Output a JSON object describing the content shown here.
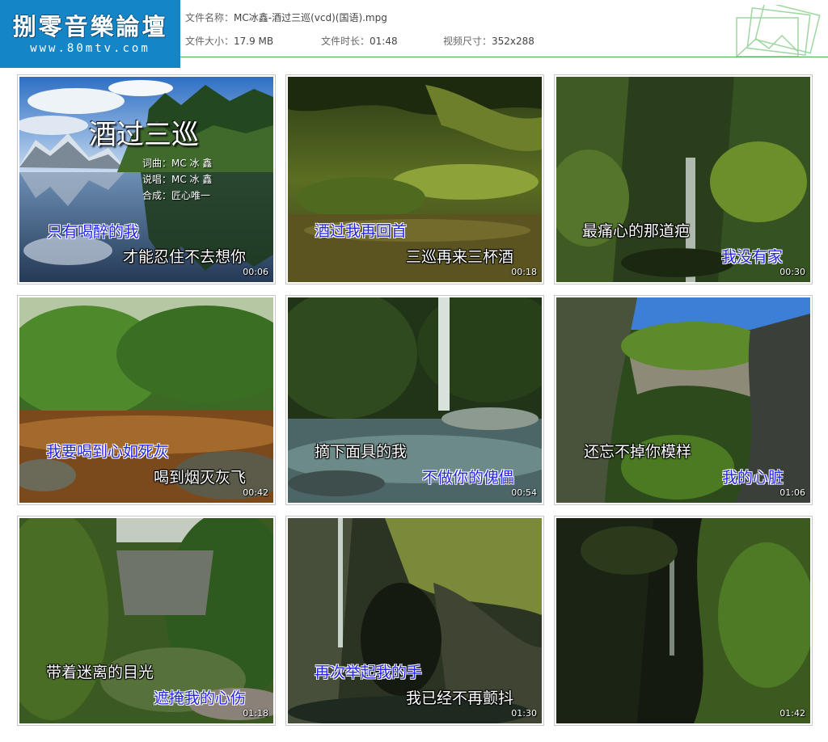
{
  "logo": {
    "title": "捌零音樂論壇",
    "url": "www.80mtv.com"
  },
  "file_info": {
    "name_label": "文件名称：",
    "name_value": "MC冰鑫-酒过三巡(vcd)(国语).mpg",
    "size_label": "文件大小：",
    "size_value": "17.9 MB",
    "duration_label": "文件时长：",
    "duration_value": "01:48",
    "dimensions_label": "视频尺寸：",
    "dimensions_value": "352x288"
  },
  "colors": {
    "logo_bg": "#1485c7",
    "rule": "#4caf50",
    "lyric_blue": "#2424e6"
  },
  "thumbnails": [
    {
      "time": "00:06",
      "title": "酒过三巡",
      "credits": [
        "词曲：MC 冰 鑫",
        "说唱：MC 冰 鑫",
        "合成：匠心唯一"
      ],
      "lyric_top": "只有喝醉的我",
      "lyric_bottom": "才能忍住不去想你"
    },
    {
      "time": "00:18",
      "lyric_top": "酒过我再回首",
      "lyric_bottom": "三巡再来三杯酒"
    },
    {
      "time": "00:30",
      "lyric_top": "最痛心的那道疤",
      "lyric_bottom": "我没有家"
    },
    {
      "time": "00:42",
      "lyric_top": "我要喝到心如死灰",
      "lyric_bottom": "喝到烟灭灰飞"
    },
    {
      "time": "00:54",
      "lyric_top": "摘下面具的我",
      "lyric_bottom": "不做你的傀儡"
    },
    {
      "time": "01:06",
      "lyric_top": "还忘不掉你模样",
      "lyric_bottom": "我的心脏"
    },
    {
      "time": "01:18",
      "lyric_top": "带着迷离的目光",
      "lyric_bottom": "遮掩我的心伤"
    },
    {
      "time": "01:30",
      "lyric_top": "再次举起我的手",
      "lyric_bottom": "我已经不再颤抖"
    },
    {
      "time": "01:42"
    }
  ]
}
